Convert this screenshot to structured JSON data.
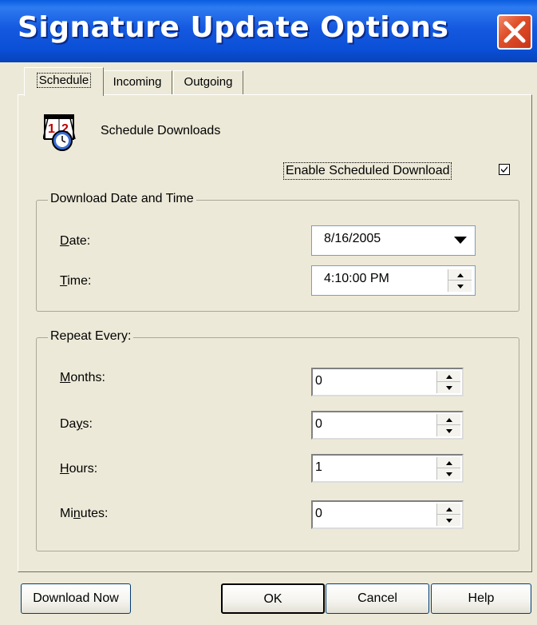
{
  "window": {
    "title": "Signature Update Options"
  },
  "tabs": [
    {
      "label": "Schedule"
    },
    {
      "label": "Incoming"
    },
    {
      "label": "Outgoing"
    }
  ],
  "schedule": {
    "heading": "Schedule Downloads",
    "enable_label": "Enable Scheduled Download",
    "enable_checked": true,
    "icon": "calendar-clock-icon"
  },
  "download_group": {
    "title": "Download Date and Time",
    "date_label": "Date:",
    "date_value": "8/16/2005",
    "time_label": "Time:",
    "time_value": "4:10:00 PM"
  },
  "repeat_group": {
    "title": "Repeat Every:",
    "fields": [
      {
        "label": "Months:",
        "value": "0"
      },
      {
        "label": "Days:",
        "value": "0"
      },
      {
        "label": "Hours:",
        "value": "1"
      },
      {
        "label": "Minutes:",
        "value": "0"
      }
    ]
  },
  "buttons": {
    "download_now": "Download Now",
    "ok": "OK",
    "cancel": "Cancel",
    "help": "Help"
  },
  "colors": {
    "titlebar": "#0A4FD6",
    "close": "#E0502A",
    "dialog_bg": "#ECE9D8"
  }
}
